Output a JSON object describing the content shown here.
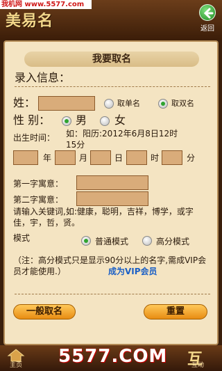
{
  "watermark": "我机网 www.5577.com",
  "logo": "美易名",
  "back_label": "返回",
  "title": "我要取名",
  "section": "录入信息：",
  "surname_label": "姓：",
  "single_name": "取单名",
  "double_name": "取双名",
  "gender_label": "性 别：",
  "male": "男",
  "female": "女",
  "birth_label": "出生时间：",
  "birth_value": "如：阳历:2012年6月8日12时15分",
  "units": {
    "year": "年",
    "month": "月",
    "day": "日",
    "hour": "时",
    "minute": "分"
  },
  "first_char_label": "第一字寓意：",
  "second_char_label": "第二字寓意：",
  "hint": "请输入关键词,如:健康，聪明，吉祥，博学，或字佳，宇，哲，贤。",
  "mode_label": "模式",
  "normal_mode": "普通模式",
  "high_mode": "高分模式",
  "note": "（注：高分模式只是显示90分以上的名字,需成VIP会员才能使用.）",
  "vip_link": "成为VIP会员",
  "btn_generate": "一般取名",
  "btn_reset": "重置",
  "tab_home": "主页",
  "tab_interact": "互动",
  "hu_char": "互",
  "big_watermark": "5577.COM"
}
